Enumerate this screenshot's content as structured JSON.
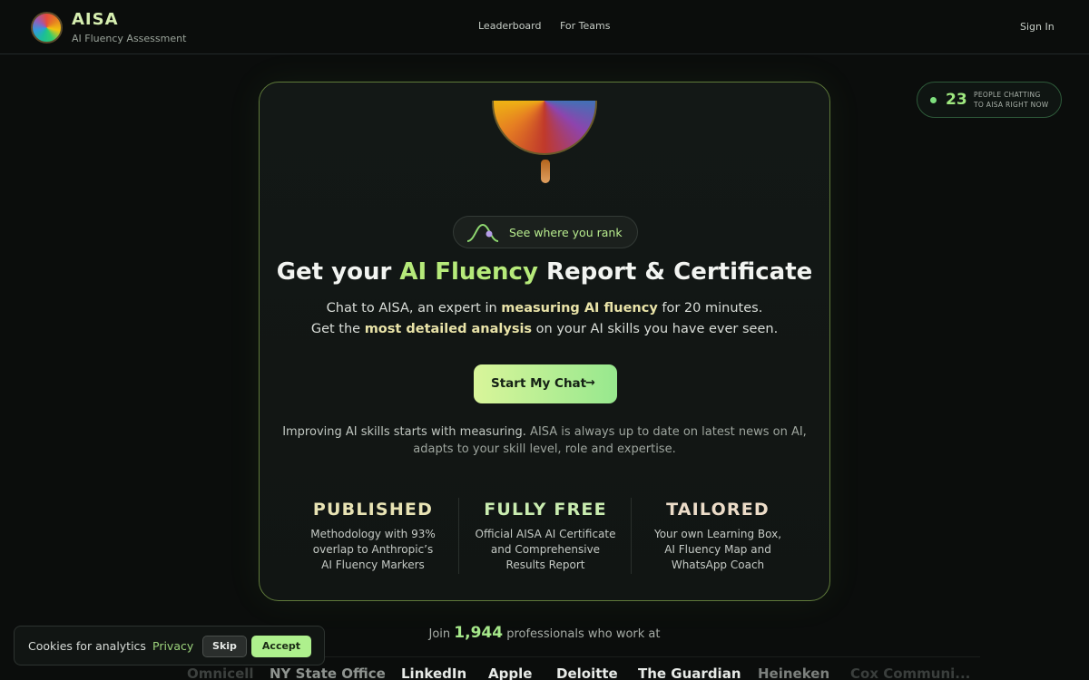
{
  "header": {
    "brand": "AISA",
    "subtitle": "AI Fluency Assessment",
    "nav": [
      "Leaderboard",
      "For Teams"
    ],
    "sign_in": "Sign In"
  },
  "live": {
    "count": "23",
    "line1": "PEOPLE CHATTING",
    "line2": "TO AISA RIGHT NOW"
  },
  "hero": {
    "rank_pill": "See where you rank",
    "headline_pre": "Get your",
    "headline_accent": "AI Fluency",
    "headline_post": "Report & Certificate",
    "lead1_pre": "Chat to AISA, an expert in",
    "lead1_accent": "measuring AI fluency",
    "lead1_post": "for 20 minutes.",
    "lead2_pre": "Get the",
    "lead2_accent": "most detailed analysis",
    "lead2_post": "on your AI skills you have ever seen.",
    "cta_label": "Start My Chat",
    "cta_arrow": "→",
    "note1_pre": "Improving AI skills starts with measuring.",
    "note1_post": "AISA is always up to date on latest news on AI,",
    "note2": "adapts to your skill level, role and expertise."
  },
  "features": [
    {
      "title": "PUBLISHED",
      "desc": [
        "Methodology with 93%",
        "overlap to Anthropic’s",
        "AI Fluency Markers"
      ]
    },
    {
      "title": "FULLY FREE",
      "desc": [
        "Official AISA AI Certificate",
        "and Comprehensive",
        "Results Report"
      ]
    },
    {
      "title": "TAILORED",
      "desc": [
        "Your own Learning Box,",
        "AI Fluency Map and",
        "WhatsApp Coach"
      ]
    }
  ],
  "join": {
    "pre": "Join",
    "count": "1,944",
    "post": "professionals who work at"
  },
  "companies": [
    "Omnicell",
    "NY State Office",
    "LinkedIn",
    "Apple",
    "Deloitte",
    "The Guardian",
    "Heineken",
    "Cox Communi..."
  ],
  "cookie": {
    "text": "Cookies for analytics",
    "privacy": "Privacy",
    "skip": "Skip",
    "accept": "Accept"
  },
  "colors": {
    "accent_green": "#b6ea7a",
    "cta_gradient_start": "#d9f59a",
    "cta_gradient_end": "#97e88e",
    "background": "#0b0d0c"
  }
}
